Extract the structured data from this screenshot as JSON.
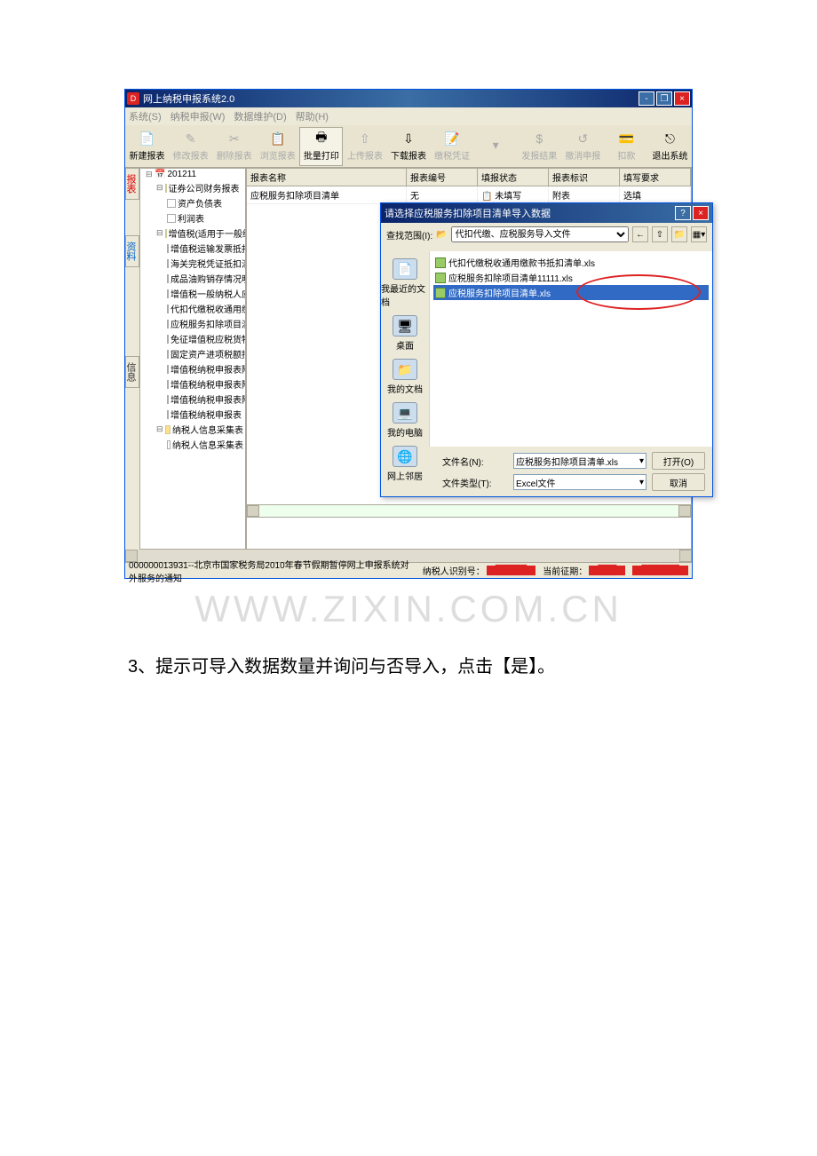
{
  "window": {
    "title": "网上纳税申报系统2.0",
    "controls": {
      "min": "-",
      "max": "❐",
      "close": "×"
    }
  },
  "menu": {
    "items": [
      "系统(S)",
      "纳税申报(W)",
      "数据维护(D)",
      "帮助(H)"
    ]
  },
  "toolbar": {
    "items": [
      {
        "label": "新建报表",
        "icon": "📄",
        "enabled": true
      },
      {
        "label": "修改报表",
        "icon": "✎",
        "enabled": false
      },
      {
        "label": "删除报表",
        "icon": "✂",
        "enabled": false
      },
      {
        "label": "浏览报表",
        "icon": "📋",
        "enabled": false
      },
      {
        "label": "批量打印",
        "icon": "🖶",
        "enabled": true
      },
      {
        "label": "上传报表",
        "icon": "⇧",
        "enabled": false
      },
      {
        "label": "下载报表",
        "icon": "⇩",
        "enabled": true
      },
      {
        "label": "缴税凭证",
        "icon": "📝",
        "enabled": false
      },
      {
        "label": "",
        "icon": "▾",
        "enabled": false
      },
      {
        "label": "发报结果",
        "icon": "$",
        "enabled": false
      },
      {
        "label": "撤消申报",
        "icon": "↺",
        "enabled": false
      },
      {
        "label": "扣款",
        "icon": "💳",
        "enabled": false
      },
      {
        "label": "退出系统",
        "icon": "⎋",
        "enabled": true
      }
    ]
  },
  "leftTabs": [
    "报表",
    "资料",
    "信息"
  ],
  "tree": {
    "root": "201211",
    "groups": [
      {
        "label": "证券公司财务报表（月报）",
        "children": [
          "资产负债表",
          "利润表"
        ]
      },
      {
        "label": "增值税(适用于一般纳税",
        "children": [
          "增值税运输发票抵扣",
          "海关完税凭证抵扣清",
          "成品油购销存情况明",
          "增值税一般纳税人应",
          "代扣代缴税收通用缴",
          "应税服务扣除项目清",
          "免征增值税应税货物",
          "固定资产进项税额抵",
          "增值税纳税申报表附",
          "增值税纳税申报表附",
          "增值税纳税申报表附",
          "增值税纳税申报表（"
        ]
      },
      {
        "label": "纳税人信息采集表",
        "children": [
          "纳税人信息采集表"
        ]
      }
    ]
  },
  "grid": {
    "headers": [
      "报表名称",
      "报表编号",
      "填报状态",
      "报表标识",
      "填写要求"
    ],
    "row": [
      "应税服务扣除项目清单",
      "无",
      "未填写",
      "附表",
      "选填"
    ],
    "status_icon": "📋"
  },
  "dialog": {
    "title": "请选择应税服务扣除项目清单导入数据",
    "help": "?",
    "close": "×",
    "look_in_label": "查找范围(I):",
    "look_in_value": "代扣代缴、应税服务导入文件",
    "nav": [
      {
        "icon": "📄",
        "label": "我最近的文档"
      },
      {
        "icon": "🖥",
        "label": "桌面"
      },
      {
        "icon": "📁",
        "label": "我的文档"
      },
      {
        "icon": "💻",
        "label": "我的电脑"
      },
      {
        "icon": "🌐",
        "label": "网上邻居"
      }
    ],
    "files": [
      "代扣代缴税收通用缴款书抵扣清单.xls",
      "应税服务扣除项目清单11111.xls",
      "应税服务扣除项目清单.xls"
    ],
    "filename_label": "文件名(N):",
    "filename_value": "应税服务扣除项目清单.xls",
    "filetype_label": "文件类型(T):",
    "filetype_value": "Excel文件",
    "open_btn": "打开(O)",
    "cancel_btn": "取消",
    "mini_buttons": [
      "←",
      "⇧",
      "📁",
      "▦▾"
    ]
  },
  "statusbar": {
    "notice": "000000013931--北京市国家税务局2010年春节假期暂停网上申报系统对外服务的通知",
    "taxpayer_label": "纳税人识别号：",
    "period_label": "当前征期："
  },
  "watermark": "WWW.ZIXIN.COM.CN",
  "caption": "3、提示可导入数据数量并询问与否导入，点击【是】。"
}
